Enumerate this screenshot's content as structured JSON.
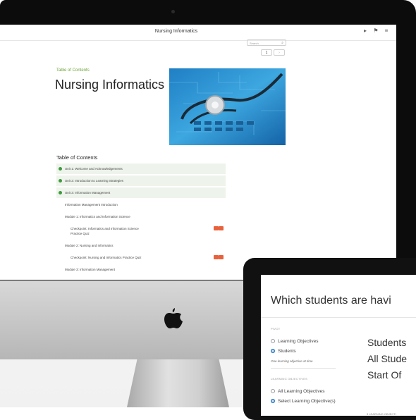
{
  "desktop": {
    "app_title": "Nursing Informatics",
    "search_placeholder": "Search",
    "page_number": "1",
    "next_arrow": "›",
    "toc_label": "Table of Contents",
    "book_title": "Nursing Informatics",
    "toc_heading": "Table of Contents",
    "toc_items": [
      {
        "label": "Unit 1: Welcome and Acknowledgements"
      },
      {
        "label": "Unit 2: Introduction to Learning Strategies"
      },
      {
        "label": "Unit 3: Information Management"
      },
      {
        "label": "Information Management Introduction"
      },
      {
        "label": "Module 1: Informatics and Information Science"
      },
      {
        "label": "Checkpoint: Informatics and Information Science"
      },
      {
        "label": "Practice Quiz"
      },
      {
        "label": "Module 2: Nursing and Informatics"
      },
      {
        "label": "Checkpoint: Nursing and Informatics Practice Quiz"
      },
      {
        "label": "Module 3: Information Management"
      }
    ],
    "icons": {
      "play": "play-icon",
      "bookmark": "bookmark-icon",
      "menu": "menu-icon",
      "search": "search-icon"
    }
  },
  "laptop": {
    "heading": "Which students are havi",
    "pivot_label": "PIVOT",
    "pivot_options": [
      "Learning Objectives",
      "Students"
    ],
    "pivot_note": "One learning objective at time",
    "lo_label": "LEARNING OBJECTIVES",
    "lo_options": [
      "All Learning Objectives",
      "Select Learning Objective(s)"
    ],
    "big_lines": [
      "Students",
      "All Stude",
      "Start Of"
    ],
    "footer": "3 LEARNING OBJECTI"
  },
  "colors": {
    "accent_green": "#3e9b3e",
    "toc_link_green": "#6aa53a",
    "radio_blue": "#2c7cc8",
    "badge_orange": "#e8613c"
  }
}
